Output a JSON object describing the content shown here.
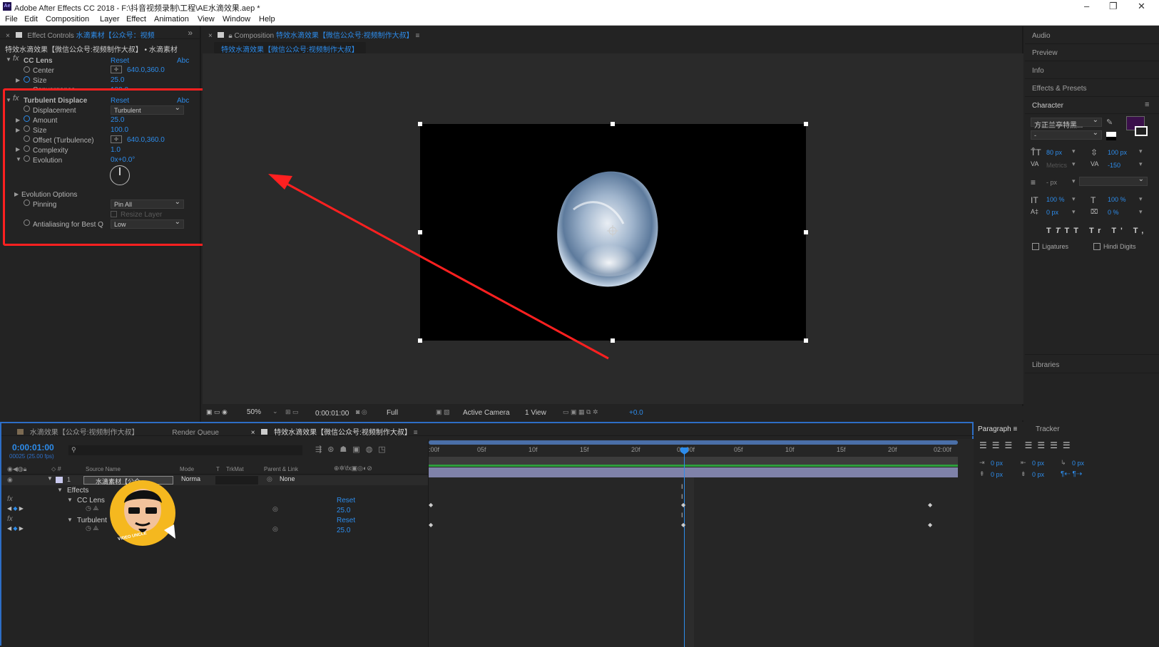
{
  "window": {
    "app_title": "Adobe After Effects CC 2018 - F:\\抖音视频录制\\工程\\AE水滴效果.aep *",
    "logo": "Ae"
  },
  "menu": [
    "File",
    "Edit",
    "Composition",
    "Layer",
    "Effect",
    "Animation",
    "View",
    "Window",
    "Help"
  ],
  "effect_controls": {
    "tab_label": "Effect Controls",
    "tab_layer": "水滴素材【公众号：视频",
    "breadcrumb": "特效水滴效果【微信公众号:视频制作大叔】 • 水滴素材",
    "cc_lens": {
      "name": "CC Lens",
      "reset": "Reset",
      "abc": "Abc",
      "center_label": "Center",
      "center_value": "640.0,360.0",
      "size_label": "Size",
      "size_value": "25.0",
      "convergence_label": "Convergence",
      "convergence_value": "100.0"
    },
    "turbulent": {
      "name": "Turbulent Displace",
      "reset": "Reset",
      "abc": "Abc",
      "displacement_label": "Displacement",
      "displacement_value": "Turbulent",
      "amount_label": "Amount",
      "amount_value": "25.0",
      "size_label": "Size",
      "size_value": "100.0",
      "offset_label": "Offset (Turbulence)",
      "offset_value": "640.0,360.0",
      "complexity_label": "Complexity",
      "complexity_value": "1.0",
      "evolution_label": "Evolution",
      "evolution_value": "0x+0.0°",
      "evolution_options": "Evolution Options",
      "pinning_label": "Pinning",
      "pinning_value": "Pin All",
      "resize_layer": "Resize Layer",
      "antialias_label": "Antialiasing for Best Q",
      "antialias_value": "Low"
    }
  },
  "composition": {
    "tab_label": "Composition",
    "comp_name": "特效水滴效果【微信公众号:视频制作大叔】",
    "sub_tab": "特效水滴效果【微信公众号:视频制作大叔】",
    "footer": {
      "zoom": "50%",
      "timecode": "0:00:01:00",
      "resolution": "Full",
      "camera": "Active Camera",
      "views": "1 View",
      "exposure": "+0.0"
    }
  },
  "right_panel": {
    "items": [
      "Audio",
      "Preview",
      "Info",
      "Effects & Presets"
    ],
    "character_title": "Character",
    "font": "方正兰亭特黑...",
    "font_style": "-",
    "font_size": "80 px",
    "leading": "100 px",
    "kerning": "Metrics",
    "tracking": "-150",
    "stroke": "- px",
    "vscale": "100 %",
    "hscale": "100 %",
    "baseline": "0 px",
    "tsume": "0 %",
    "ligatures": "Ligatures",
    "hindi_digits": "Hindi Digits",
    "libraries": "Libraries",
    "fill_color": "#3a0f4a"
  },
  "timeline": {
    "tabs": [
      "水滴效果【公众号:视频制作大叔】",
      "Render Queue",
      "特效水滴效果【微信公众号:视频制作大叔】"
    ],
    "timecode": "0:00:01:00",
    "fps": "00025 (25.00 fps)",
    "cols": {
      "source": "Source Name",
      "mode": "Mode",
      "t": "T",
      "trkmat": "TrkMat",
      "parent": "Parent & Link"
    },
    "layer": {
      "num": "1",
      "name": "水滴素材【公众",
      "mode": "Norma",
      "parent": "None"
    },
    "effects_label": "Effects",
    "cc_lens": "CC Lens",
    "turbulent": "Turbulent",
    "reset": "Reset",
    "val1": "25.0",
    "val2": "25.0",
    "ruler": [
      ":00f",
      "05f",
      "10f",
      "15f",
      "20f",
      "01:00f",
      "05f",
      "10f",
      "15f",
      "20f",
      "02:00f"
    ]
  },
  "para_panel": {
    "tabs": [
      "Paragraph",
      "Tracker"
    ],
    "values": [
      "0 px",
      "0 px",
      "0 px",
      "0 px",
      "0 px"
    ]
  },
  "avatar_text": "VIDEO UNCLE",
  "colors": {
    "accent": "#2d8ceb",
    "highlight_box": "#ff2020",
    "arrow": "#ff2020"
  }
}
